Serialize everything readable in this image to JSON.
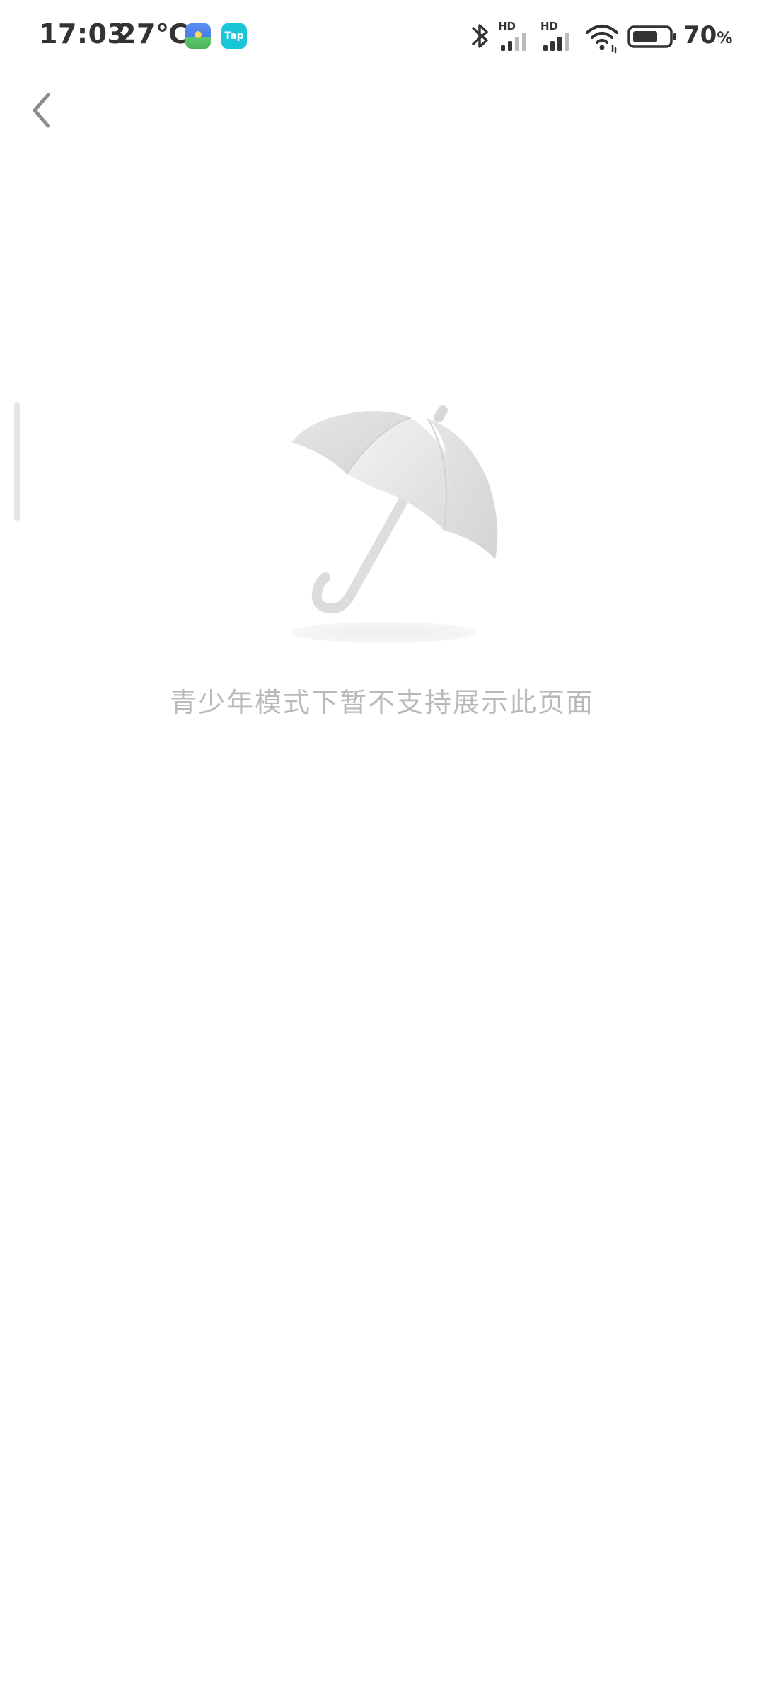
{
  "status_bar": {
    "time": "17:03",
    "temperature": "27℃",
    "battery_percent": "70",
    "battery_unit": "%",
    "battery_level": 0.7,
    "icons": [
      "gallery-app-icon",
      "tap-app-icon",
      "bluetooth-icon",
      "signal-hd-icon",
      "signal-hd-icon",
      "wifi-icon",
      "battery-icon"
    ],
    "tap_label": "Tap",
    "hd_label": "HD"
  },
  "header": {
    "back_icon": "chevron-left-icon"
  },
  "empty_state": {
    "illustration": "umbrella-icon",
    "message": "青少年模式下暂不支持展示此页面"
  },
  "colors": {
    "text_primary": "#333333",
    "message": "#b9b9b9",
    "icon_gray": "#8e8e8e",
    "background": "#ffffff"
  }
}
